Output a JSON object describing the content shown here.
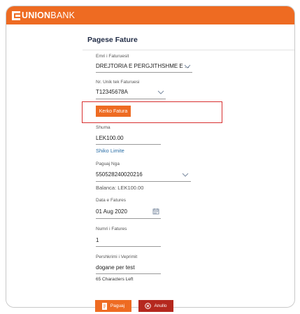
{
  "brand": {
    "name_bold": "UNION",
    "name_light": "BANK",
    "color": "#ee6b22"
  },
  "page": {
    "title": "Pagese Fature"
  },
  "form": {
    "emri_label": "Emri i Faturuesit",
    "emri_value": "DREJTORIA E PERGJITHSHME E ...",
    "nr_label": "Nr. Unik tek Faturuesi",
    "nr_value": "T12345678A",
    "kerko_button": "Kerko Fatura",
    "shuma_label": "Shuma",
    "shuma_value": "LEK100.00",
    "shiko_limite": "Shiko Limite",
    "paguaj_nga_label": "Paguaj Nga",
    "paguaj_nga_value": "550528240020216",
    "balanca": "Balanca: LEK100.00",
    "data_label": "Data e Fatures",
    "data_value": "01 Aug 2020",
    "numri_label": "Numri i Fatures",
    "numri_value": "1",
    "pershkrimi_label": "Pershkrimi i Veprimit",
    "pershkrimi_value": "dogane per test",
    "characters_left": "65 Characters Left"
  },
  "actions": {
    "pay_label": "Paguaj",
    "cancel_label": "Anullo"
  },
  "colors": {
    "accent": "#ee6b22",
    "cancel": "#b5281e",
    "highlight": "#d82f2f",
    "link": "#2a6ea6"
  }
}
